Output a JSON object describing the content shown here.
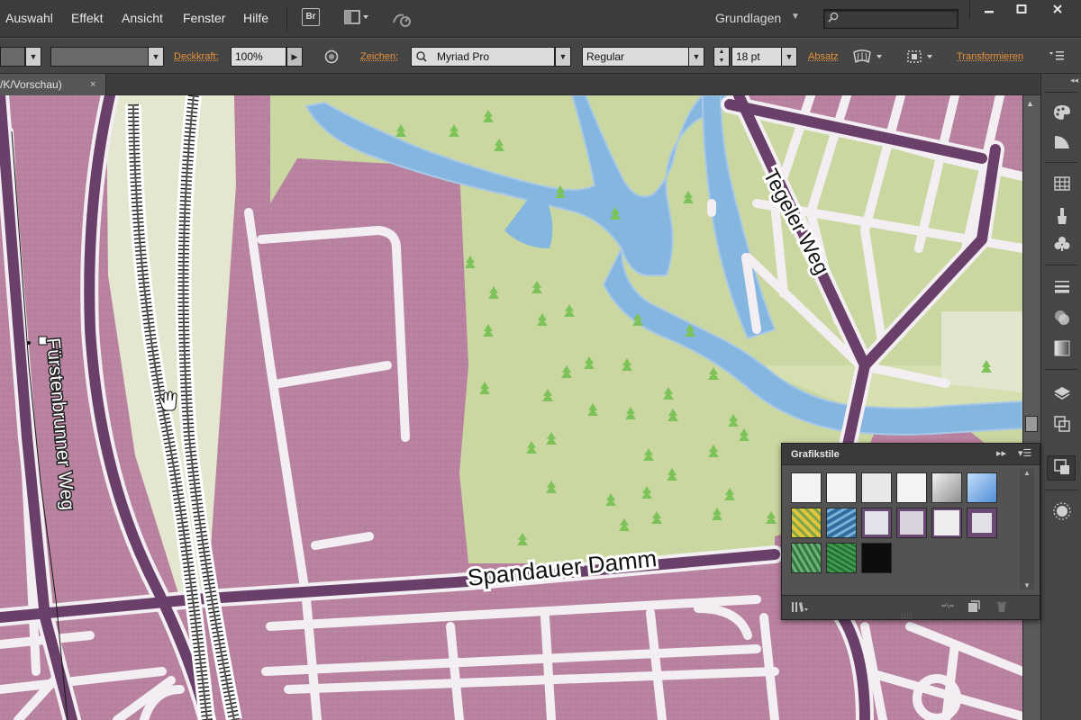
{
  "menubar": {
    "items": [
      "Auswahl",
      "Effekt",
      "Ansicht",
      "Fenster",
      "Hilfe"
    ],
    "bridge_label": "Br",
    "workspace_label": "Grundlagen",
    "search_placeholder": "",
    "window_controls": [
      "minimize-icon",
      "maximize-icon",
      "close-icon"
    ]
  },
  "controlbar": {
    "opacity_label": "Deckkraft:",
    "opacity_value": "100%",
    "character_label": "Zeichen:",
    "font_family": "Myriad Pro",
    "font_style": "Regular",
    "font_size": "18 pt",
    "paragraph_label": "Absatz",
    "transform_label": "Transformieren"
  },
  "document_tab": {
    "title": "/K/Vorschau)",
    "close_glyph": "×"
  },
  "map": {
    "street_labels": {
      "tegeler": "Tegeler Weg",
      "spandauer": "Spandauer Damm",
      "fuerstenbrunner": "Fürstenbrunner Weg"
    },
    "colors": {
      "block": "#b8819f",
      "road": "#6a3f6a",
      "street": "#f2eef2",
      "park": "#cbd7a1",
      "water": "#84b6e0",
      "tree": "#7dc35a",
      "sand": "#e4e6cf"
    }
  },
  "panel": {
    "title": "Grafikstile",
    "collapse_glyph": "▸▸",
    "menu_glyph": "▾☰",
    "swatches": [
      {
        "name": "default-style",
        "color": "#f4f4f4"
      },
      {
        "name": "no-stroke-style",
        "color": "#f4f4f4"
      },
      {
        "name": "shadow-style",
        "color": "#e8e8e8"
      },
      {
        "name": "no-fill-style",
        "color": "#f4f4f4"
      },
      {
        "name": "gray-gradient-style",
        "color": "#c8c8c8"
      },
      {
        "name": "blue-gradient-style",
        "color": "#6ca6e0"
      },
      {
        "name": "yellow-texture-style",
        "color": "#d9c43a"
      },
      {
        "name": "blue-texture-style",
        "color": "#4a86b8"
      },
      {
        "name": "outline-light-style",
        "color": "#e2e2ea"
      },
      {
        "name": "outline-purple-style",
        "color": "#d7d2dc"
      },
      {
        "name": "outline-thin-style",
        "color": "#eeeeee"
      },
      {
        "name": "outline-thick-style",
        "color": "#e4e0e8"
      },
      {
        "name": "green-texture-style",
        "color": "#3c8a4a"
      },
      {
        "name": "green-pattern-style",
        "color": "#2f7a3a"
      },
      {
        "name": "black-style",
        "color": "#0d0d0d"
      }
    ]
  }
}
